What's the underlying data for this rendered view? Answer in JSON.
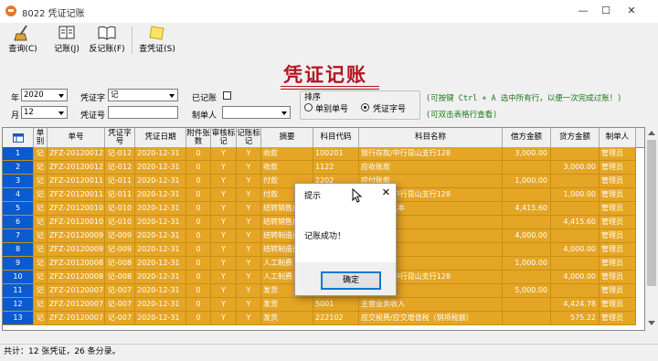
{
  "window": {
    "title": "8022 凭证记账",
    "minimize": "—",
    "maximize": "☐",
    "close": "✕"
  },
  "toolbar": {
    "query": "查询(C)",
    "post": "记账(J)",
    "unpost": "反记账(F)",
    "view_voucher": "查凭证(S)"
  },
  "page_title": "凭证记账",
  "filters": {
    "year_label": "年",
    "year_value": "2020",
    "month_label": "月",
    "month_value": "12",
    "voucher_word_label": "凭证字",
    "voucher_word_value": "记",
    "voucher_no_label": "凭证号",
    "voucher_no_value": "",
    "posted_label": "已记账",
    "bookkeeper_label": "制单人",
    "bookkeeper_value": ""
  },
  "sort": {
    "title": "排序",
    "option1": "单别单号",
    "option2": "凭证字号",
    "selected": "凭证字号"
  },
  "hints": {
    "line1": "(可按键 Ctrl + A 选中所有行，以便一次完成过账！)",
    "line2": "(可双击表格行查看)"
  },
  "table": {
    "columns": [
      "单别",
      "单号",
      "凭证字号",
      "凭证日期",
      "附件张数",
      "审核标记",
      "记账标记",
      "摘要",
      "科目代码",
      "科目名称",
      "借方金额",
      "贷方金额",
      "制单人"
    ],
    "rows": [
      [
        "1",
        "记",
        "ZFZ-20120012",
        "记-012",
        "2020-12-31",
        "0",
        "Y",
        "Y",
        "收款",
        "100201",
        "银行存款/中行昆山支行128",
        "3,000.00",
        "",
        "管理员"
      ],
      [
        "2",
        "记",
        "ZFZ-20120012",
        "记-012",
        "2020-12-31",
        "0",
        "Y",
        "Y",
        "收款",
        "1122",
        "应收账款",
        "",
        "3,000.00",
        "管理员"
      ],
      [
        "3",
        "记",
        "ZFZ-20120011",
        "记-011",
        "2020-12-31",
        "0",
        "Y",
        "Y",
        "付款",
        "2202",
        "应付账款",
        "1,000.00",
        "",
        "管理员"
      ],
      [
        "4",
        "记",
        "ZFZ-20120011",
        "记-011",
        "2020-12-31",
        "0",
        "Y",
        "Y",
        "付款",
        "100201",
        "银行存款/中行昆山支行128",
        "",
        "1,000.00",
        "管理员"
      ],
      [
        "5",
        "记",
        "ZFZ-20120010",
        "记-010",
        "2020-12-31",
        "0",
        "Y",
        "Y",
        "结转销售成本",
        "6401",
        "主营业务成本",
        "4,415.60",
        "",
        "管理员"
      ],
      [
        "6",
        "记",
        "ZFZ-20120010",
        "记-010",
        "2020-12-31",
        "0",
        "Y",
        "Y",
        "结转销售成本",
        "1405",
        "库存商品",
        "",
        "4,415.60",
        "管理员"
      ],
      [
        "7",
        "记",
        "ZFZ-20120009",
        "记-009",
        "2020-12-31",
        "0",
        "Y",
        "Y",
        "结转制造费用",
        "5001",
        "生产成本",
        "4,000.00",
        "",
        "管理员"
      ],
      [
        "8",
        "记",
        "ZFZ-20120009",
        "记-009",
        "2020-12-31",
        "0",
        "Y",
        "Y",
        "结转制造费用",
        "5101",
        "制造费用",
        "",
        "4,000.00",
        "管理员"
      ],
      [
        "9",
        "记",
        "ZFZ-20120008",
        "记-008",
        "2020-12-31",
        "0",
        "Y",
        "Y",
        "人工制费",
        "5101",
        "制造费用",
        "1,000.00",
        "",
        "管理员"
      ],
      [
        "10",
        "记",
        "ZFZ-20120008",
        "记-008",
        "2020-12-31",
        "0",
        "Y",
        "Y",
        "人工制费",
        "100201",
        "银行存款/中行昆山支行128",
        "",
        "4,000.00",
        "管理员"
      ],
      [
        "11",
        "记",
        "ZFZ-20120007",
        "记-007",
        "2020-12-31",
        "0",
        "Y",
        "Y",
        "发货",
        "1122",
        "应收账款",
        "5,000.00",
        "",
        "管理员"
      ],
      [
        "12",
        "记",
        "ZFZ-20120007",
        "记-007",
        "2020-12-31",
        "0",
        "Y",
        "Y",
        "发货",
        "5001",
        "主营业务收入",
        "",
        "4,424.78",
        "管理员"
      ],
      [
        "13",
        "记",
        "ZFZ-20120007",
        "记-007",
        "2020-12-31",
        "0",
        "Y",
        "Y",
        "发货",
        "222102",
        "应交税费/应交增值税（销项税额）",
        "",
        "575.22",
        "管理员"
      ]
    ]
  },
  "status": "共计：12 张凭证，26 条分录。",
  "dialog": {
    "title": "提示",
    "message": "记账成功！",
    "ok": "确定",
    "close": "✕"
  }
}
